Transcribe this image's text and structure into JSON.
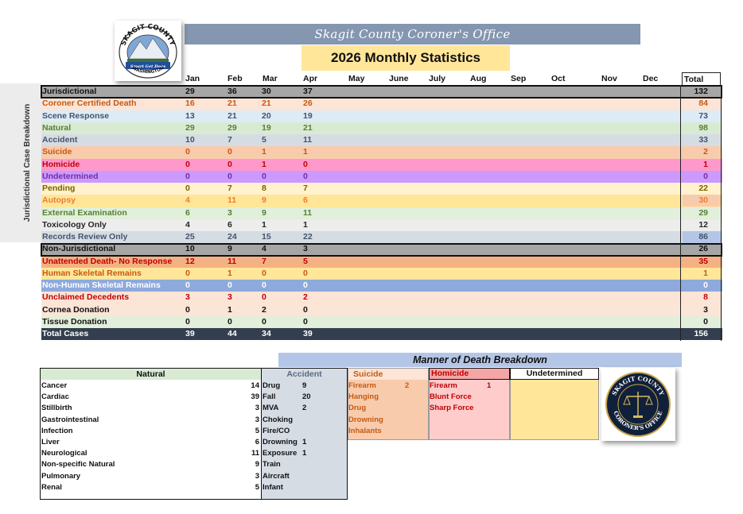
{
  "header": {
    "title": "Skagit County Coroner's Office",
    "subtitle": "2026 Monthly Statistics",
    "side_label": "Jurisdictional Case Breakdown",
    "total_label": "Total",
    "logo_top_text": "SKAGIT COUNTY",
    "logo_banner_text": "Smart Get Dogs",
    "logo_bottom_text": "WASHINGTON",
    "seal_top_text": "SKAGIT COUNTY",
    "seal_bottom_text": "CORONER'S OFFICE"
  },
  "months": [
    "Jan",
    "Feb",
    "Mar",
    "Apr",
    "May",
    "June",
    "July",
    "Aug",
    "Sep",
    "Oct",
    "Nov",
    "Dec"
  ],
  "rows": [
    {
      "label": "Jurisdictional",
      "values": [
        "29",
        "36",
        "30",
        "37"
      ],
      "total": "132",
      "bg": "#a6a6a6",
      "color": "#111111",
      "total_bg": "#a6a6a6"
    },
    {
      "label": "Coroner Certified Death",
      "values": [
        "16",
        "21",
        "21",
        "26"
      ],
      "total": "84",
      "bg": "#fce4d6",
      "color": "#c55a11",
      "total_bg": "#fce4d6"
    },
    {
      "label": "Scene Response",
      "values": [
        "13",
        "21",
        "20",
        "19"
      ],
      "total": "73",
      "bg": "#ddebf7",
      "color": "#44546a",
      "total_bg": "#ddebf7"
    },
    {
      "label": "Natural",
      "values": [
        "29",
        "29",
        "19",
        "21"
      ],
      "total": "98",
      "bg": "#d9ead3",
      "color": "#548235",
      "total_bg": "#d9ead3"
    },
    {
      "label": "Accident",
      "values": [
        "10",
        "7",
        "5",
        "11"
      ],
      "total": "33",
      "bg": "#d6dce4",
      "color": "#44546a",
      "total_bg": "#d6dce4"
    },
    {
      "label": "Suicide",
      "values": [
        "0",
        "0",
        "1",
        "1"
      ],
      "total": "2",
      "bg": "#f8cbad",
      "color": "#c55a11",
      "total_bg": "#f8cbad"
    },
    {
      "label": "Homicide",
      "values": [
        "0",
        "0",
        "1",
        "0"
      ],
      "total": "1",
      "bg": "#ff99cc",
      "color": "#c00000",
      "total_bg": "#ff99cc"
    },
    {
      "label": "Undetermined",
      "values": [
        "0",
        "0",
        "0",
        "0"
      ],
      "total": "0",
      "bg": "#cc99ff",
      "color": "#7030a0",
      "total_bg": "#cc99ff"
    },
    {
      "label": "Pending",
      "values": [
        "0",
        "7",
        "8",
        "7"
      ],
      "total": "22",
      "bg": "#fff2cc",
      "color": "#7f6000",
      "total_bg": "#fff2cc"
    },
    {
      "label": "Autopsy",
      "values": [
        "4",
        "11",
        "9",
        "6"
      ],
      "total": "30",
      "bg": "#ffe699",
      "color": "#ed7d31",
      "total_bg": "#f8cbad"
    },
    {
      "label": "External Examination",
      "values": [
        "6",
        "3",
        "9",
        "11"
      ],
      "total": "29",
      "bg": "#e2efda",
      "color": "#548235",
      "total_bg": "#e2efda"
    },
    {
      "label": "Toxicology Only",
      "values": [
        "4",
        "6",
        "1",
        "1"
      ],
      "total": "12",
      "bg": "#ededed",
      "color": "#262626",
      "total_bg": "#ededed"
    },
    {
      "label": "Records Review Only",
      "values": [
        "25",
        "24",
        "15",
        "22"
      ],
      "total": "86",
      "bg": "#d6dce4",
      "color": "#44546a",
      "total_bg": "#b4c6e7"
    },
    {
      "label": "Non-Jurisdictional",
      "values": [
        "10",
        "9",
        "4",
        "3"
      ],
      "total": "26",
      "bg": "#a6a6a6",
      "color": "#111111",
      "total_bg": "#a6a6a6"
    },
    {
      "label": "Unattended Death- No Response",
      "values": [
        "12",
        "11",
        "7",
        "5"
      ],
      "total": "35",
      "bg": "#f4b183",
      "color": "#c00000",
      "total_bg": "#f4b183"
    },
    {
      "label": "Human Skeletal Remains",
      "values": [
        "0",
        "1",
        "0",
        "0"
      ],
      "total": "1",
      "bg": "#ffe699",
      "color": "#c55a11",
      "total_bg": "#ffe699"
    },
    {
      "label": "Non-Human Skeletal Remains",
      "values": [
        "0",
        "0",
        "0",
        "0"
      ],
      "total": "0",
      "bg": "#8ea9db",
      "color": "#ffffff",
      "total_bg": "#8ea9db"
    },
    {
      "label": "Unclaimed Decedents",
      "values": [
        "3",
        "3",
        "0",
        "2"
      ],
      "total": "8",
      "bg": "#fce4d6",
      "color": "#c00000",
      "total_bg": "#fce4d6"
    },
    {
      "label": "Cornea Donation",
      "values": [
        "0",
        "1",
        "2",
        "0"
      ],
      "total": "3",
      "bg": "#fbe5d6",
      "color": "#111111",
      "total_bg": "#fbe5d6"
    },
    {
      "label": "Tissue Donation",
      "values": [
        "0",
        "0",
        "0",
        "0"
      ],
      "total": "0",
      "bg": "#e2efda",
      "color": "#111111",
      "total_bg": "#e2efda"
    },
    {
      "label": "Total Cases",
      "values": [
        "39",
        "44",
        "34",
        "39"
      ],
      "total": "156",
      "bg": "#333f4f",
      "color": "#ffffff",
      "total_bg": "#333f4f"
    }
  ],
  "manner": {
    "title": "Manner of Death Breakdown",
    "natural": {
      "heading": "Natural",
      "items": [
        {
          "label": "Cancer",
          "value": "14"
        },
        {
          "label": "Cardiac",
          "value": "39"
        },
        {
          "label": "Stillbirth",
          "value": "3"
        },
        {
          "label": "Gastrointestinal",
          "value": "3"
        },
        {
          "label": "Infection",
          "value": "5"
        },
        {
          "label": "Liver",
          "value": "6"
        },
        {
          "label": "Neurological",
          "value": "11"
        },
        {
          "label": "Non-specific Natural",
          "value": "9"
        },
        {
          "label": "Pulmonary",
          "value": "3"
        },
        {
          "label": "Renal",
          "value": "5"
        }
      ]
    },
    "accident": {
      "heading": "Accident",
      "items": [
        {
          "label": "Drug",
          "value": "9"
        },
        {
          "label": "Fall",
          "value": "20"
        },
        {
          "label": "MVA",
          "value": "2"
        },
        {
          "label": "Choking",
          "value": ""
        },
        {
          "label": "Fire/CO",
          "value": ""
        },
        {
          "label": "Drowning",
          "value": "1"
        },
        {
          "label": "Exposure",
          "value": "1"
        },
        {
          "label": "Train",
          "value": ""
        },
        {
          "label": "Aircraft",
          "value": ""
        },
        {
          "label": "Infant",
          "value": ""
        }
      ]
    },
    "suicide": {
      "heading": "Suicide",
      "items": [
        {
          "label": "Firearm",
          "value": "2"
        },
        {
          "label": "Hanging",
          "value": ""
        },
        {
          "label": "Drug",
          "value": ""
        },
        {
          "label": "Drowning",
          "value": ""
        },
        {
          "label": "Inhalants",
          "value": ""
        }
      ]
    },
    "homicide": {
      "heading": "Homicide",
      "items": [
        {
          "label": "Firearm",
          "value": "1"
        },
        {
          "label": "Blunt Force",
          "value": ""
        },
        {
          "label": "Sharp Force",
          "value": ""
        }
      ]
    },
    "undetermined": {
      "heading": "Undetermined"
    }
  }
}
